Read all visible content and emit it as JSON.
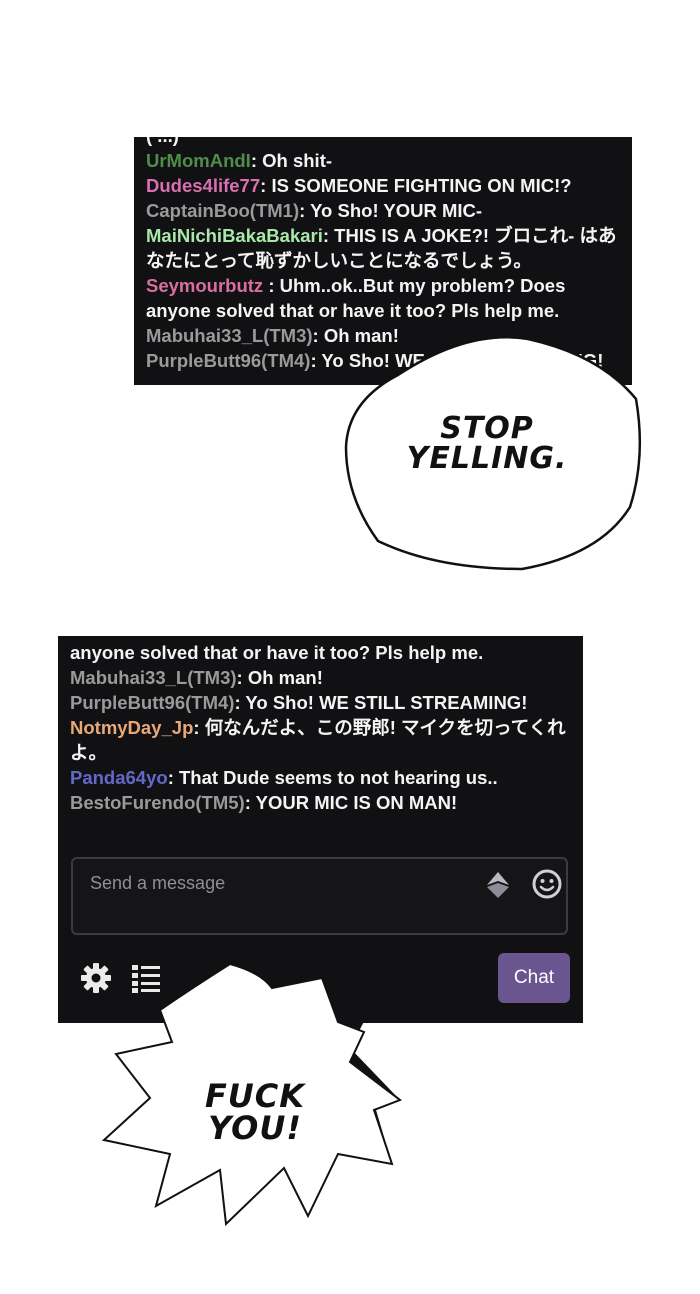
{
  "panel_top": {
    "messages": [
      {
        "user": "",
        "user_color": "#f4f4f4",
        "text": "( ...) ʽ ʿʾ ʻ ʽ ʿ ʾ ʻ"
      },
      {
        "user": "UrMomAndI",
        "user_color": "#4f8e4a",
        "text": ": Oh shit-"
      },
      {
        "user": "Dudes4life77",
        "user_color": "#d86fb0",
        "text": ": IS SOMEONE FIGHTING ON MIC!?"
      },
      {
        "user": "CaptainBoo(TM1)",
        "user_color": "#9a9a9a",
        "text": ": Yo Sho! YOUR MIC-"
      },
      {
        "user": "MaiNichiBakaBakari",
        "user_color": "#a8e8a8",
        "text": ": THIS IS A JOKE?! ブロこれ- はあなたにとって恥ずかしいことになるでしょう。"
      },
      {
        "user": "Seymourbutz",
        "user_color": "#d86fa0",
        "text": " : Uhm..ok..But my problem? Does anyone solved that or have it too? Pls help me."
      },
      {
        "user": "Mabuhai33_L(TM3)",
        "user_color": "#9a9a9a",
        "text": ": Oh man!"
      },
      {
        "user": "PurpleButt96(TM4)",
        "user_color": "#9a9a9a",
        "text": ": Yo Sho! WE STILL STREAMING!"
      }
    ],
    "bubble_text": [
      "STOP",
      "YELLING."
    ]
  },
  "panel_bottom": {
    "messages": [
      {
        "user": "",
        "user_color": "#f4f4f4",
        "text": "anyone solved that or have it too? Pls help me."
      },
      {
        "user": "Mabuhai33_L(TM3)",
        "user_color": "#9a9a9a",
        "text": ": Oh man!"
      },
      {
        "user": "PurpleButt96(TM4)",
        "user_color": "#9a9a9a",
        "text": ": Yo Sho! WE STILL STREAMING!"
      },
      {
        "user": "NotmyDay_Jp",
        "user_color": "#e8a878",
        "text": ": 何なんだよ、この野郎! マイクを切ってくれよ。"
      },
      {
        "user": "Panda64yo",
        "user_color": "#6468c8",
        "text": ": That Dude seems to not hearing us.."
      },
      {
        "user": "BestoFurendo(TM5)",
        "user_color": "#9a9a9a",
        "text": ": YOUR MIC IS ON MAN!"
      }
    ],
    "input": {
      "placeholder": "Send a message"
    },
    "chat_button_label": "Chat",
    "icons": [
      "bits-icon",
      "emoji-icon",
      "gear-icon",
      "list-icon"
    ],
    "bubble_text": [
      "FUCK",
      "YOU!"
    ]
  },
  "colors": {
    "panel_bg": "#111113",
    "chat_button": "#6a5590"
  }
}
